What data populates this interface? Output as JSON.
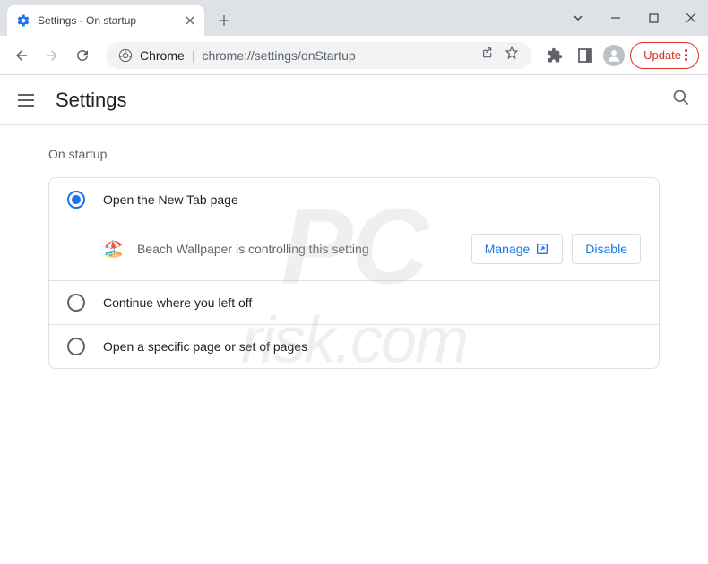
{
  "titlebar": {
    "tab_title": "Settings - On startup"
  },
  "toolbar": {
    "origin": "Chrome",
    "path": "chrome://settings/onStartup",
    "update_label": "Update"
  },
  "settings": {
    "title": "Settings"
  },
  "content": {
    "section_label": "On startup",
    "options": [
      {
        "label": "Open the New Tab page",
        "selected": true
      },
      {
        "label": "Continue where you left off",
        "selected": false
      },
      {
        "label": "Open a specific page or set of pages",
        "selected": false
      }
    ],
    "extension": {
      "icon": "🏖️",
      "text": "Beach Wallpaper is controlling this setting",
      "manage_label": "Manage",
      "disable_label": "Disable"
    }
  },
  "watermark": {
    "line1": "PC",
    "line2": "risk.com"
  }
}
